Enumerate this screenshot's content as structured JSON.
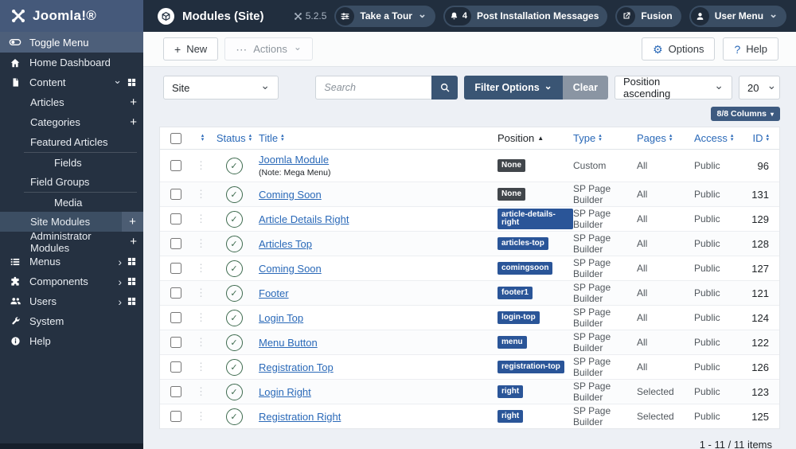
{
  "colors": {
    "header_bg": "#212e3e",
    "logo_bg": "#45597a",
    "toggle_bg": "#4d5f7a",
    "sidebar_bg": "#253141",
    "sidebar_active": "#3c4e63",
    "pill_bg": "#3a4d63",
    "pill_icon_bg": "#1f2b3a",
    "content_bg": "#edf0f5",
    "accent": "#3a5574",
    "grey_button": "#8a95a3",
    "columns_button": "#3d5a80",
    "link": "#2a69b8",
    "badge_blue": "#2a5598",
    "badge_dark": "#41464b",
    "status_green": "#3d6a4e"
  },
  "header": {
    "logo": "Joomla!®",
    "title": "Modules (Site)",
    "version": "5.2.5",
    "pills": {
      "tour": "Take a Tour",
      "messages": "Post Installation Messages",
      "messages_count": "4",
      "fusion": "Fusion",
      "user": "User Menu"
    }
  },
  "icons": {
    "title": "cube-icon",
    "tour": "sliders-icon",
    "messages": "bell-icon",
    "fusion": "external-link-icon",
    "user": "user-circle-icon",
    "search": "magnifier-icon",
    "options": "gear-icon",
    "help": "question-icon"
  },
  "sidebar": {
    "toggle": "Toggle Menu",
    "items": [
      "Home Dashboard",
      "Content",
      "Articles",
      "Categories",
      "Featured Articles",
      "Fields",
      "Field Groups",
      "Media",
      "Site Modules",
      "Administrator Modules",
      "Menus",
      "Components",
      "Users",
      "System",
      "Help"
    ]
  },
  "toolbar": {
    "new_label": "New",
    "actions_label": "Actions",
    "options_label": "Options",
    "help_label": "Help"
  },
  "filters": {
    "client": "Site",
    "search_placeholder": "Search",
    "filter_options_label": "Filter Options",
    "clear_label": "Clear",
    "sort_value": "Position ascending",
    "limit_value": "20",
    "columns_label": "8/8 Columns"
  },
  "table": {
    "headers": {
      "status": "Status",
      "title": "Title",
      "position": "Position",
      "type": "Type",
      "pages": "Pages",
      "access": "Access",
      "id": "ID"
    },
    "rows": [
      {
        "title": "Joomla Module",
        "note": "(Note: Mega Menu)",
        "position": "None",
        "badge": "dark",
        "type": "Custom",
        "pages": "All",
        "access": "Public",
        "id": "96"
      },
      {
        "title": "Coming Soon",
        "note": "",
        "position": "None",
        "badge": "dark",
        "type": "SP Page Builder",
        "pages": "All",
        "access": "Public",
        "id": "131"
      },
      {
        "title": "Article Details Right",
        "note": "",
        "position": "article-details-right",
        "badge": "blue",
        "type": "SP Page Builder",
        "pages": "All",
        "access": "Public",
        "id": "129"
      },
      {
        "title": "Articles Top",
        "note": "",
        "position": "articles-top",
        "badge": "blue",
        "type": "SP Page Builder",
        "pages": "All",
        "access": "Public",
        "id": "128"
      },
      {
        "title": "Coming Soon",
        "note": "",
        "position": "comingsoon",
        "badge": "blue",
        "type": "SP Page Builder",
        "pages": "All",
        "access": "Public",
        "id": "127"
      },
      {
        "title": "Footer",
        "note": "",
        "position": "footer1",
        "badge": "blue",
        "type": "SP Page Builder",
        "pages": "All",
        "access": "Public",
        "id": "121"
      },
      {
        "title": "Login Top",
        "note": "",
        "position": "login-top",
        "badge": "blue",
        "type": "SP Page Builder",
        "pages": "All",
        "access": "Public",
        "id": "124"
      },
      {
        "title": "Menu Button",
        "note": "",
        "position": "menu",
        "badge": "blue",
        "type": "SP Page Builder",
        "pages": "All",
        "access": "Public",
        "id": "122"
      },
      {
        "title": "Registration Top",
        "note": "",
        "position": "registration-top",
        "badge": "blue",
        "type": "SP Page Builder",
        "pages": "All",
        "access": "Public",
        "id": "126"
      },
      {
        "title": "Login Right",
        "note": "",
        "position": "right",
        "badge": "blue",
        "type": "SP Page Builder",
        "pages": "Selected",
        "access": "Public",
        "id": "123"
      },
      {
        "title": "Registration Right",
        "note": "",
        "position": "right",
        "badge": "blue",
        "type": "SP Page Builder",
        "pages": "Selected",
        "access": "Public",
        "id": "125"
      }
    ]
  },
  "footer": {
    "items_count": "1 - 11 / 11 items"
  }
}
